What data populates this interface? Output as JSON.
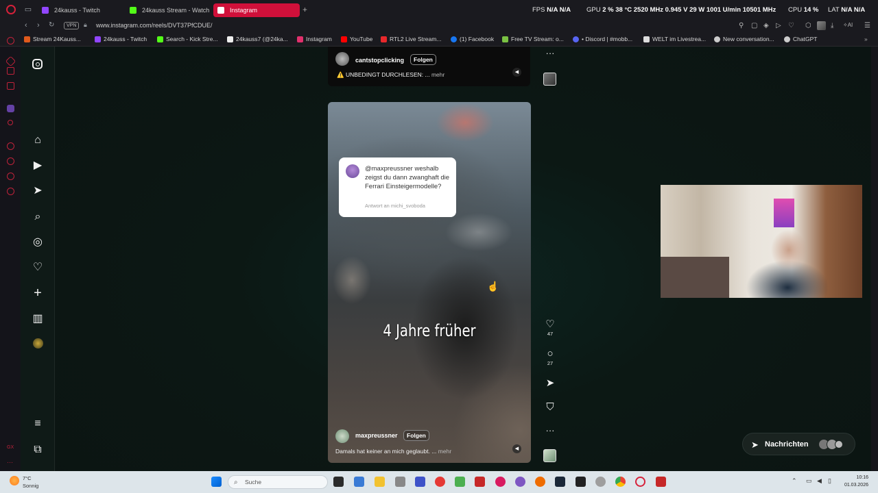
{
  "browser": {
    "tabs": [
      {
        "label": "24kauss - Twitch",
        "color": "#9146ff"
      },
      {
        "label": "24kauss Stream - Watch I",
        "color": "#53fc18"
      },
      {
        "label": "Instagram",
        "color": "#e1306c",
        "active": true
      }
    ],
    "new_tab": "+",
    "url": "www.instagram.com/reels/DVT37PfCDUE/",
    "vpn_label": "VPN",
    "stats": {
      "fps_label": "FPS",
      "fps_value": "N/A N/A",
      "gpu_label": "GPU",
      "gpu_value": "2 %  38 °C  2520 MHz  0.945 V  29 W  1001 U/min  10501 MHz",
      "cpu_label": "CPU",
      "cpu_value": "14 %",
      "lat_label": "LAT",
      "lat_value": "N/A N/A"
    },
    "bookmarks": [
      {
        "label": "Stream 24Kauss...",
        "color": "#e05a1c"
      },
      {
        "label": "24kauss - Twitch",
        "color": "#9146ff"
      },
      {
        "label": "Search - Kick Stre...",
        "color": "#53fc18"
      },
      {
        "label": "24kauss7 (@24ka...",
        "color": "#eeeeee"
      },
      {
        "label": "Instagram",
        "color": "#e1306c"
      },
      {
        "label": "YouTube",
        "color": "#ff0000"
      },
      {
        "label": "RTL2 Live Stream...",
        "color": "#e8282b"
      },
      {
        "label": "(1) Facebook",
        "color": "#1877f2"
      },
      {
        "label": "Free TV Stream: o...",
        "color": "#7ac143"
      },
      {
        "label": "• Discord | #mobb...",
        "color": "#5865f2"
      },
      {
        "label": "WELT im Livestrea...",
        "color": "#dddddd"
      },
      {
        "label": "New conversation...",
        "color": "#cccccc"
      },
      {
        "label": "ChatGPT",
        "color": "#cccccc"
      }
    ]
  },
  "reels": {
    "previous": {
      "username": "cantstopclicking",
      "follow": "Folgen",
      "caption": "⚠️ UNBEDINGT DURCHLESEN: ...",
      "more": "mehr"
    },
    "current": {
      "reply_text": "@maxpreussner weshalb zeigst du dann zwanghaft die Ferrari Einsteigermodelle?",
      "reply_sub": "Antwort an michi_svoboda",
      "overlay_text": "4 Jahre früher",
      "username": "maxpreussner",
      "follow": "Folgen",
      "caption": "Damals hat keiner an mich geglaubt. ...",
      "more": "mehr",
      "likes": "47",
      "comments": "27"
    }
  },
  "messages_label": "Nachrichten",
  "taskbar": {
    "weather_temp": "7°C",
    "weather_desc": "Sonnig",
    "search_placeholder": "Suche",
    "time": "10:16",
    "date": "01.03.2026"
  },
  "icons": {
    "instagram": "instagram-icon",
    "home": "home-icon",
    "reels": "reels-icon",
    "send": "send-icon",
    "search": "search-icon",
    "explore": "compass-icon",
    "heart": "heart-icon",
    "create": "plus-icon",
    "dashboard": "dashboard-icon",
    "menu": "hamburger-icon",
    "more": "more-icon"
  }
}
